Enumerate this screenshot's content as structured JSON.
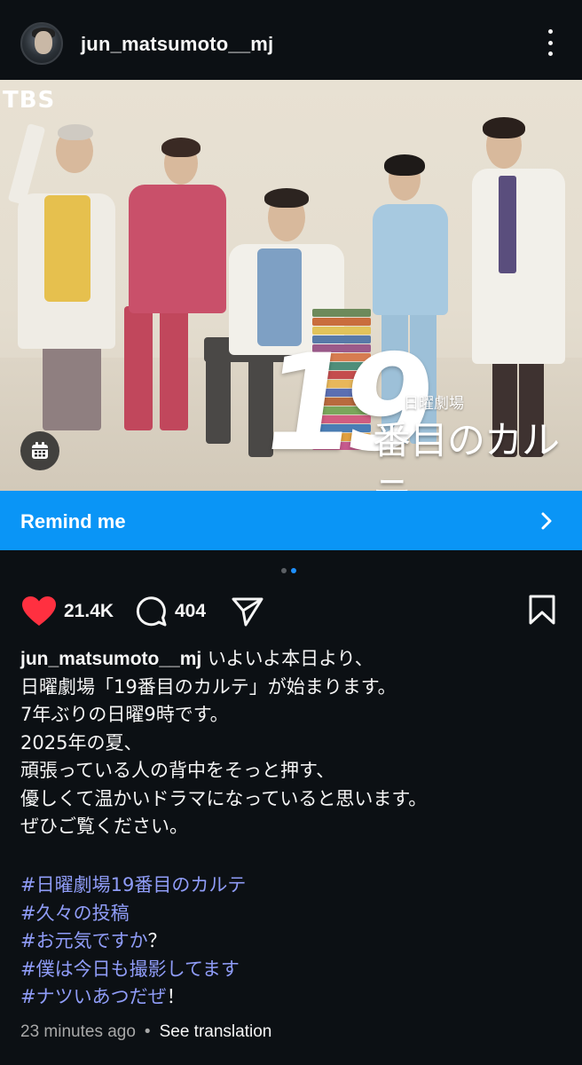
{
  "header": {
    "username": "jun_matsumoto__mj"
  },
  "photo": {
    "watermark": "TBS",
    "title_number": "19",
    "title_small": "日曜劇場",
    "title_main": "番目のカルテ"
  },
  "remind": {
    "label": "Remind me"
  },
  "carousel": {
    "count": 2,
    "active_index": 1
  },
  "actions": {
    "likes": "21.4K",
    "comments": "404",
    "like_color": "#ff3040"
  },
  "caption": {
    "username": "jun_matsumoto__mj",
    "lines": [
      "いよいよ本日より、",
      "日曜劇場「19番目のカルテ」が始まります。",
      "7年ぶりの日曜9時です。",
      "2025年の夏、",
      "頑張っている人の背中をそっと押す、",
      "優しくて温かいドラマになっていると思います。",
      "ぜひご覧ください。"
    ],
    "hashtags": [
      {
        "tag": "#日曜劇場19番目のカルテ",
        "suffix": ""
      },
      {
        "tag": "#久々の投稿",
        "suffix": ""
      },
      {
        "tag": "#お元気ですか",
        "suffix": "？"
      },
      {
        "tag": "#僕は今日も撮影してます",
        "suffix": ""
      },
      {
        "tag": "#ナツいあつだぜ",
        "suffix": "！"
      }
    ]
  },
  "meta": {
    "time": "23 minutes ago",
    "separator": "•",
    "translate": "See translation"
  },
  "colors": {
    "background": "#0c1014",
    "accent_blue": "#0a95f6",
    "hashtag": "#8f9cf7"
  }
}
